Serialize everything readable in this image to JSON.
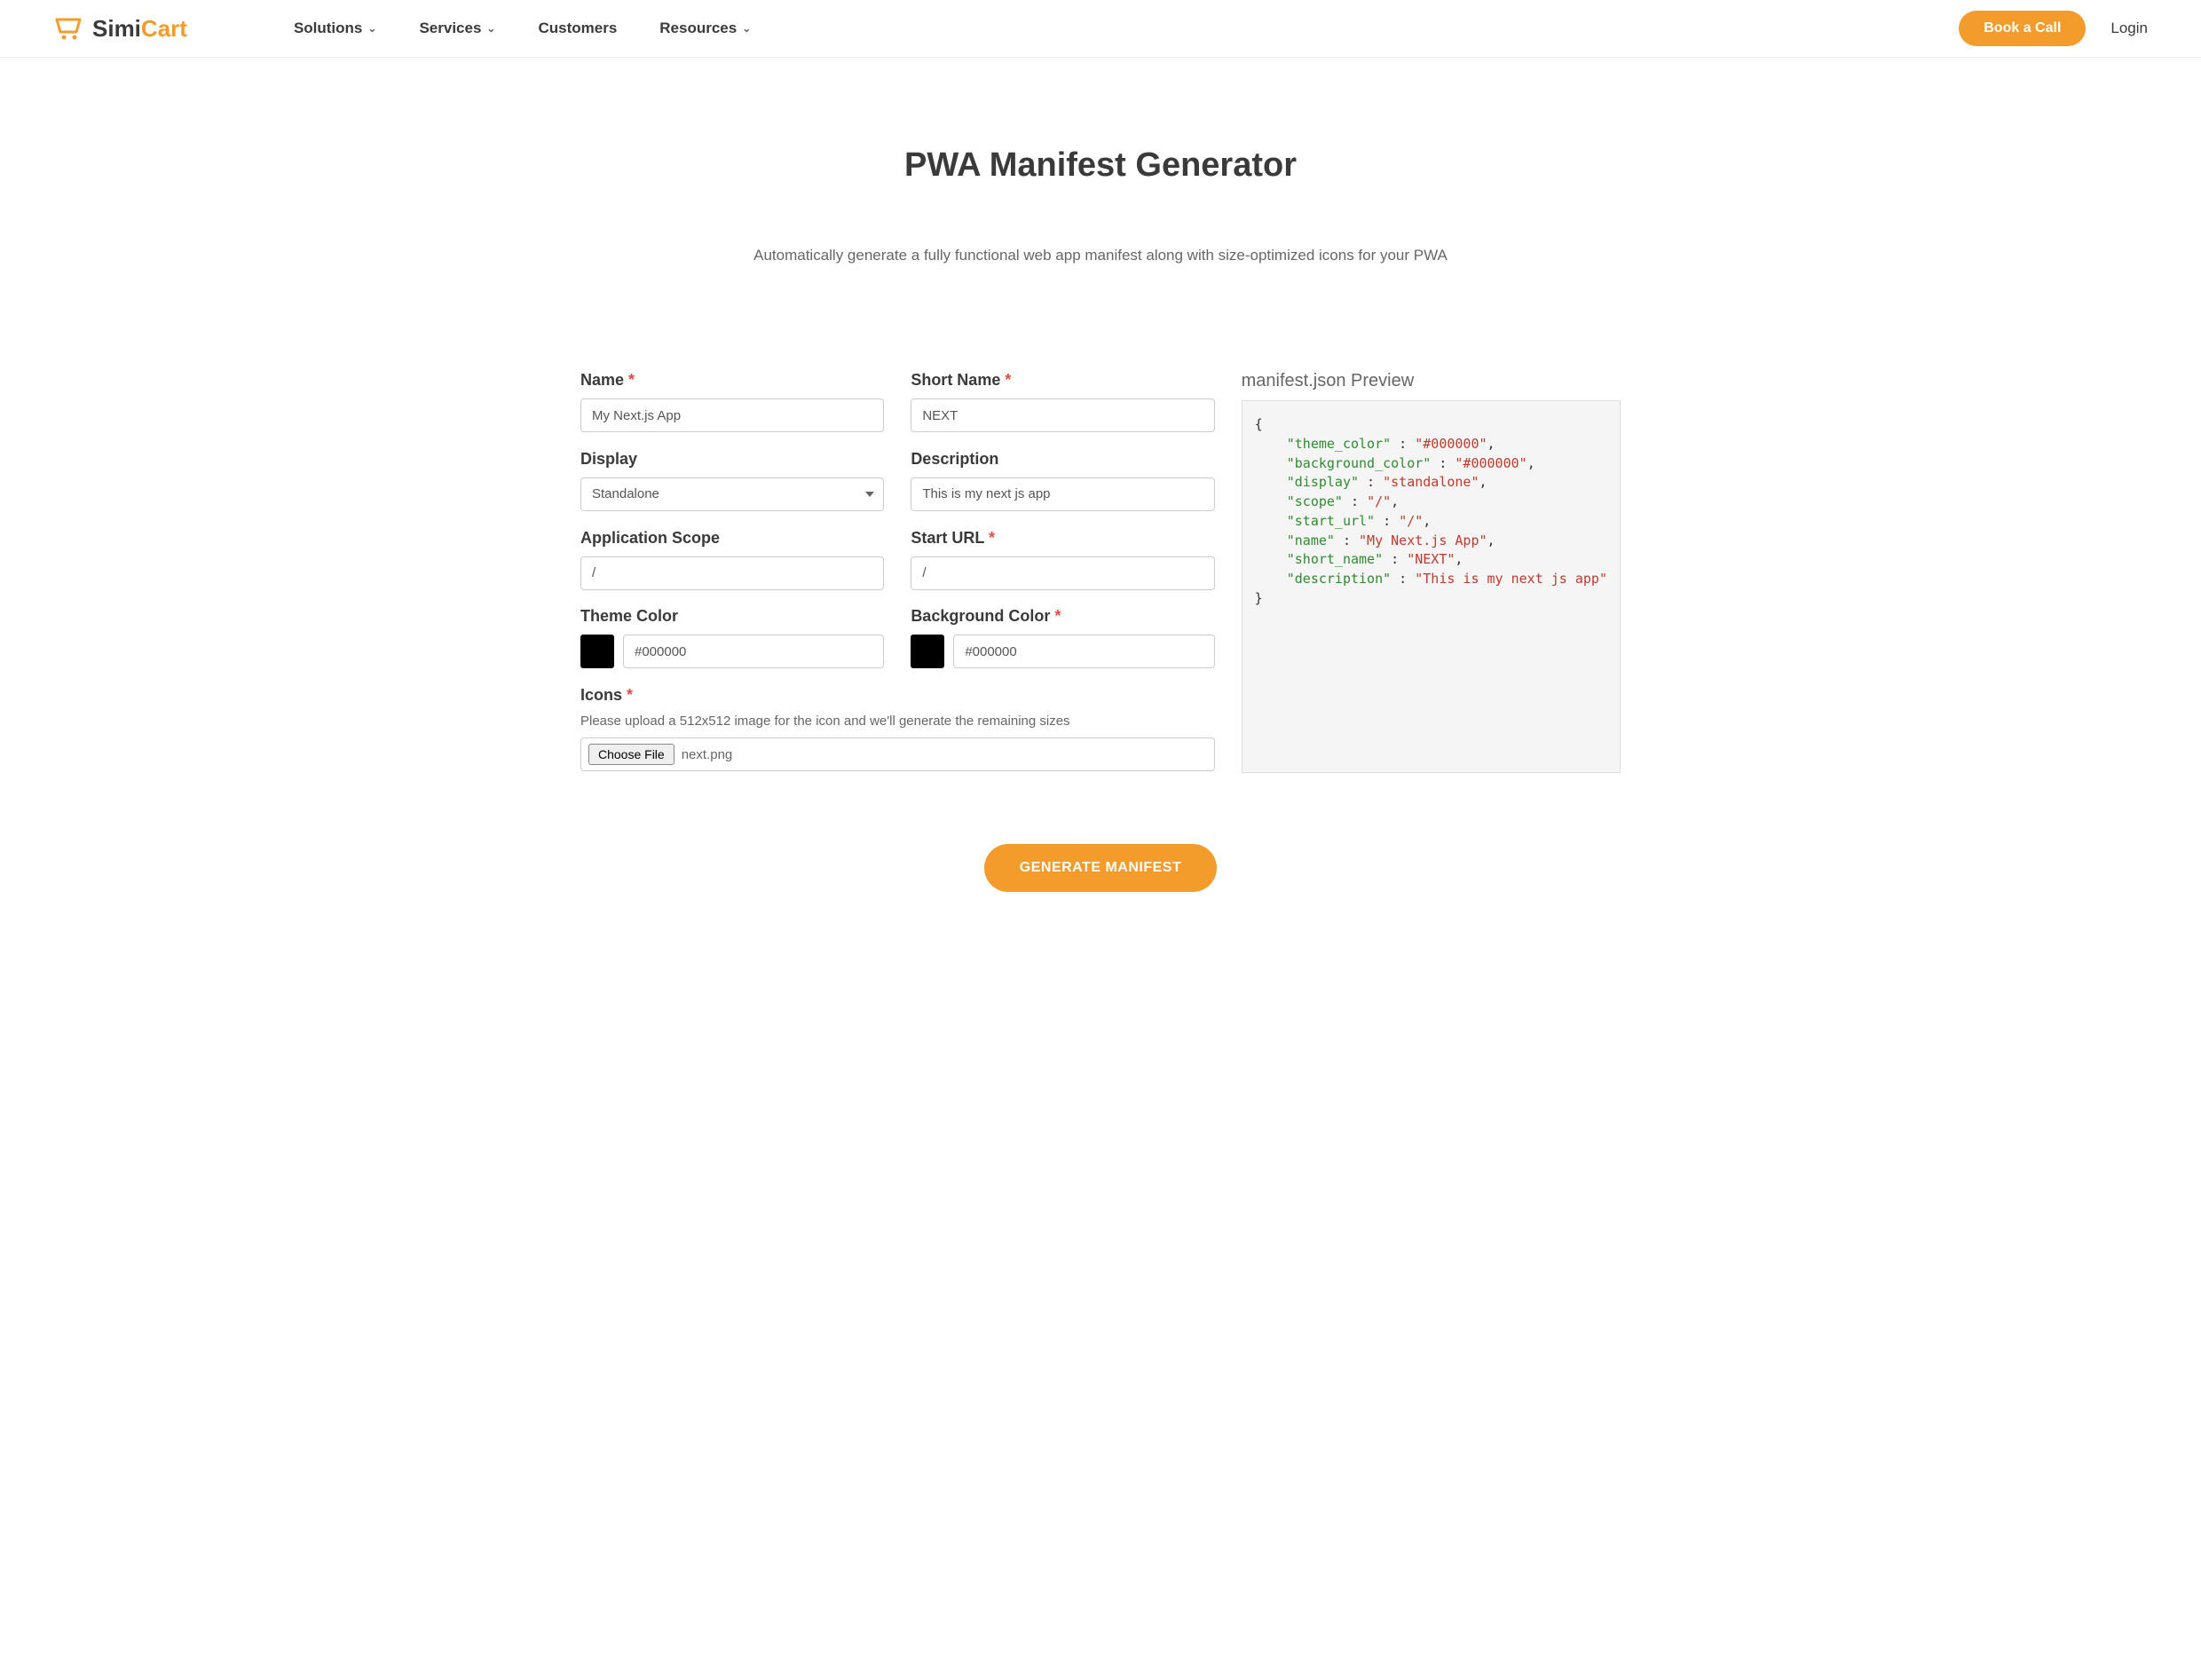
{
  "brand": {
    "name1": "Simi",
    "name2": "Cart"
  },
  "nav": {
    "solutions": "Solutions",
    "services": "Services",
    "customers": "Customers",
    "resources": "Resources"
  },
  "header": {
    "book": "Book a Call",
    "login": "Login"
  },
  "page": {
    "title": "PWA Manifest Generator",
    "subtitle": "Automatically generate a fully functional web app manifest along with size-optimized icons for your PWA"
  },
  "form": {
    "name_label": "Name",
    "name_value": "My Next.js App",
    "short_name_label": "Short Name",
    "short_name_value": "NEXT",
    "display_label": "Display",
    "display_value": "Standalone",
    "description_label": "Description",
    "description_value": "This is my next js app",
    "scope_label": "Application Scope",
    "scope_value": "/",
    "start_url_label": "Start URL",
    "start_url_value": "/",
    "theme_label": "Theme Color",
    "theme_value": "#000000",
    "bg_label": "Background Color",
    "bg_value": "#000000",
    "icons_label": "Icons",
    "icons_helper": "Please upload a 512x512 image for the icon and we'll generate the remaining sizes",
    "choose_file": "Choose File",
    "file_name": "next.png"
  },
  "preview": {
    "title": "manifest.json Preview",
    "pairs": [
      {
        "k": "\"theme_color\"",
        "v": "\"#000000\""
      },
      {
        "k": "\"background_color\"",
        "v": "\"#000000\""
      },
      {
        "k": "\"display\"",
        "v": "\"standalone\""
      },
      {
        "k": "\"scope\"",
        "v": "\"/\""
      },
      {
        "k": "\"start_url\"",
        "v": "\"/\""
      },
      {
        "k": "\"name\"",
        "v": "\"My Next.js App\""
      },
      {
        "k": "\"short_name\"",
        "v": "\"NEXT\""
      },
      {
        "k": "\"description\"",
        "v": "\"This is my next js app\""
      }
    ]
  },
  "generate": "GENERATE MANIFEST",
  "required": "*"
}
